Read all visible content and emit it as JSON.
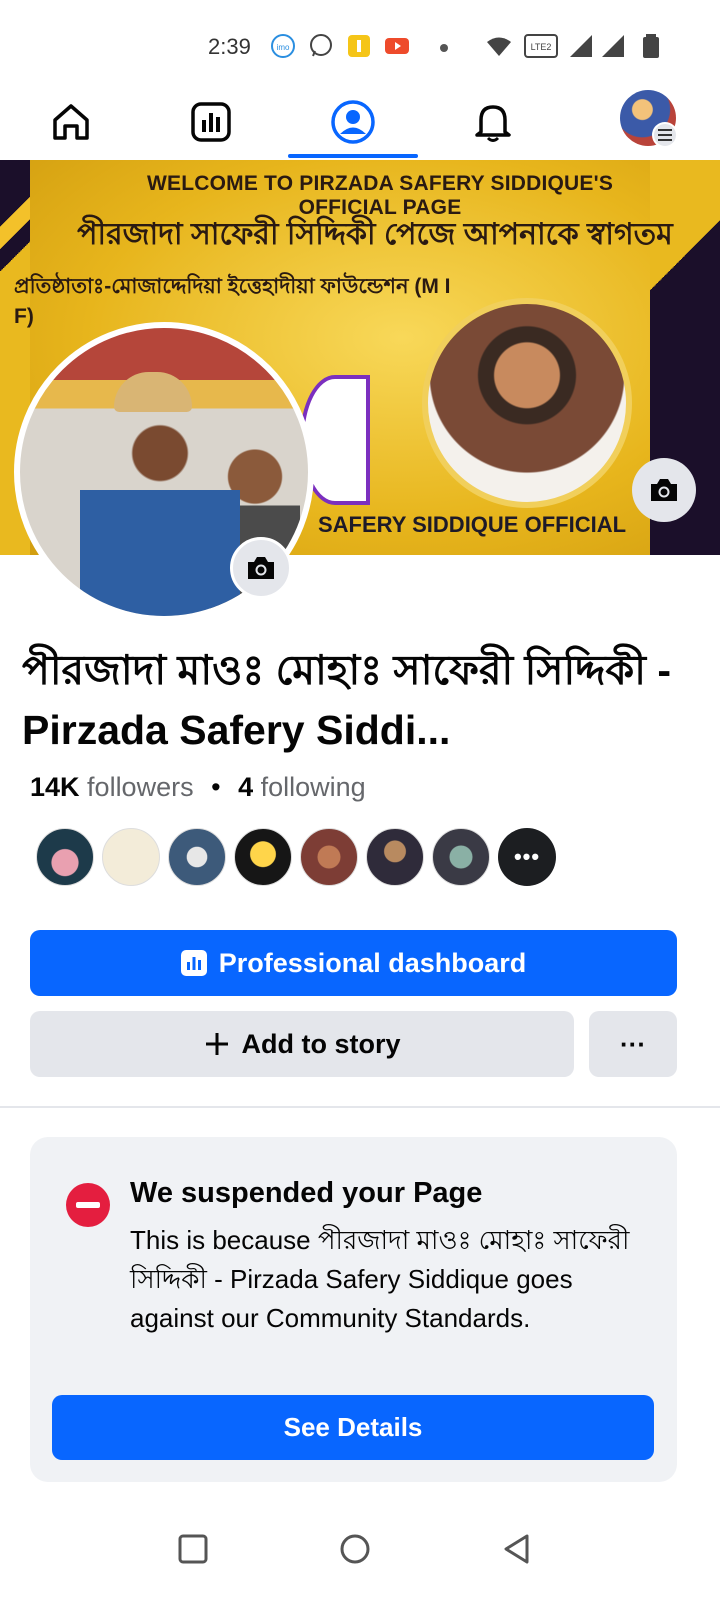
{
  "status_bar": {
    "time": "2:39",
    "icons": [
      "imo-icon",
      "whatsapp-icon",
      "notification-app-icon",
      "youtube-icon",
      "wifi-icon",
      "volte-lte2-icon",
      "signal-icon",
      "signal-icon",
      "battery-icon"
    ]
  },
  "nav": {
    "items": [
      {
        "name": "home",
        "icon": "home-icon"
      },
      {
        "name": "dashboard",
        "icon": "dashboard-icon"
      },
      {
        "name": "profile",
        "icon": "profile-icon",
        "active": true
      },
      {
        "name": "notifications",
        "icon": "bell-icon"
      },
      {
        "name": "menu",
        "icon": "avatar-menu-icon"
      }
    ],
    "accent": "#0866ff"
  },
  "cover": {
    "line1": "WELCOME TO PIRZADA SAFERY SIDDIQUE'S OFFICIAL PAGE",
    "line2": "পীরজাদা সাফেরী সিদ্দিকী পেজে আপনাকে স্বাগতম",
    "line3": "প্রতিষ্ঠাতাঃ-মোজাদ্দেদিয়া ইত্তেহাদীয়া ফাউন্ডেশন (M I F)",
    "line4": "SAFERY SIDDIQUE OFFICIAL"
  },
  "profile": {
    "name": "পীরজাদা মাওঃ মোহাঃ সাফেরী সিদ্দিকী - Pirzada Safery Siddi...",
    "followers_count": "14K",
    "followers_label": "followers",
    "separator": "•",
    "following_count": "4",
    "following_label": "following",
    "more_followers": "•••"
  },
  "actions": {
    "dashboard_label": "Professional dashboard",
    "story_label": "Add to story",
    "more_label": "···"
  },
  "suspension": {
    "title": "We suspended your Page",
    "body": "This is because পীরজাদা মাওঃ মোহাঃ সাফেরী সিদ্দিকী - Pirzada Safery Siddique goes against our Community Standards.",
    "button": "See Details",
    "icon_color": "#e41e3f"
  },
  "system_nav": [
    "recents-icon",
    "home-circle-icon",
    "back-icon"
  ]
}
